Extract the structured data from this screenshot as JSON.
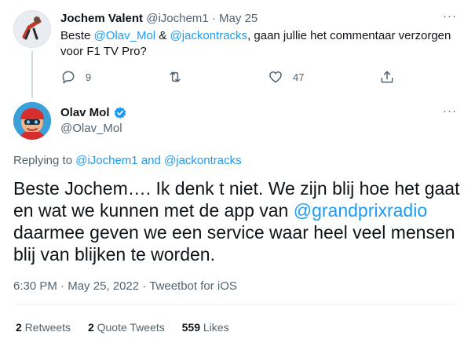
{
  "parent_tweet": {
    "author_name": "Jochem Valent",
    "author_handle": "@iJochem1",
    "separator": "·",
    "date": "May 25",
    "text_start": "Beste ",
    "mention_1": "@Olav_Mol",
    "text_amp": " & ",
    "mention_2": "@jackontracks",
    "text_rest": ", gaan jullie het commentaar verzorgen voor F1 TV Pro?",
    "more": "···",
    "reply_count": "9",
    "like_count": "47",
    "icons": [
      "reply-icon",
      "retweet-icon",
      "like-icon",
      "share-icon"
    ]
  },
  "main_tweet": {
    "author_name": "Olav Mol",
    "author_handle": "@Olav_Mol",
    "verified": true,
    "more": "···",
    "replying_prefix": "Replying to ",
    "replying_user_1": "@iJochem1",
    "replying_and": " and ",
    "replying_user_2": "@jackontracks",
    "text_start": "Beste Jochem…. Ik denk t niet. We zijn blij hoe het gaat en wat we kunnen met de app van ",
    "text_mention": "@grandprixradio",
    "text_end": " daarmee geven we een service waar heel veel mensen blij van blijken te worden.",
    "time": "6:30 PM",
    "sep_1": " · ",
    "date": "May 25, 2022",
    "sep_2": " · ",
    "client": "Tweetbot for iOS",
    "retweets_count": "2",
    "retweets_label": " Retweets",
    "quotes_count": "2",
    "quotes_label": " Quote Tweets",
    "likes_count": "559",
    "likes_label": " Likes"
  },
  "colors": {
    "accent": "#1d9bf0",
    "text": "#0f1419",
    "muted": "#536471",
    "divider": "#eff3f4"
  }
}
